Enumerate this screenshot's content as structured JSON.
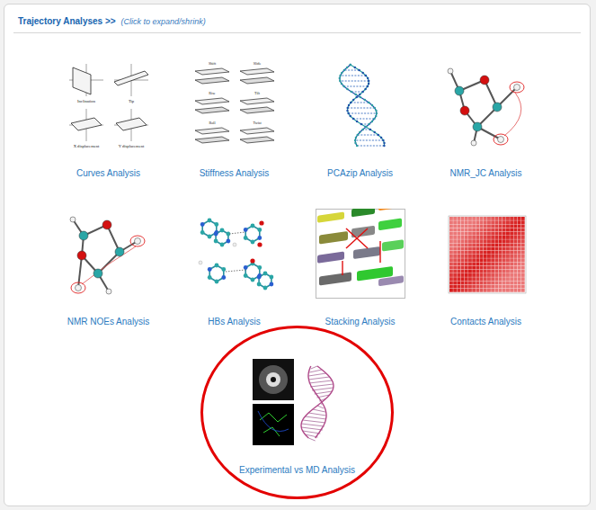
{
  "section": {
    "title": "Trajectory Analyses >>",
    "hint": "(Click to expand/shrink)",
    "expanded": true
  },
  "analyses": [
    {
      "label": "Curves Analysis",
      "kind": "curves",
      "highlighted": false,
      "figure_labels": [
        "Inclination",
        "Tip",
        "X displacement",
        "Y displacement"
      ]
    },
    {
      "label": "Stiffness Analysis",
      "kind": "stiffness",
      "highlighted": false,
      "figure_labels": [
        "Shift",
        "Slide",
        "Rise",
        "Tilt",
        "Roll",
        "Twist"
      ]
    },
    {
      "label": "PCAzip Analysis",
      "kind": "pcazip",
      "highlighted": false
    },
    {
      "label": "NMR_JC Analysis",
      "kind": "nmrjc",
      "highlighted": false
    },
    {
      "label": "NMR NOEs Analysis",
      "kind": "nmrnoe",
      "highlighted": false
    },
    {
      "label": "HBs Analysis",
      "kind": "hbs",
      "highlighted": false
    },
    {
      "label": "Stacking Analysis",
      "kind": "stacking",
      "highlighted": false
    },
    {
      "label": "Contacts Analysis",
      "kind": "contacts",
      "highlighted": false
    },
    {
      "label": "Experimental vs MD Analysis",
      "kind": "experimental",
      "highlighted": true
    }
  ]
}
